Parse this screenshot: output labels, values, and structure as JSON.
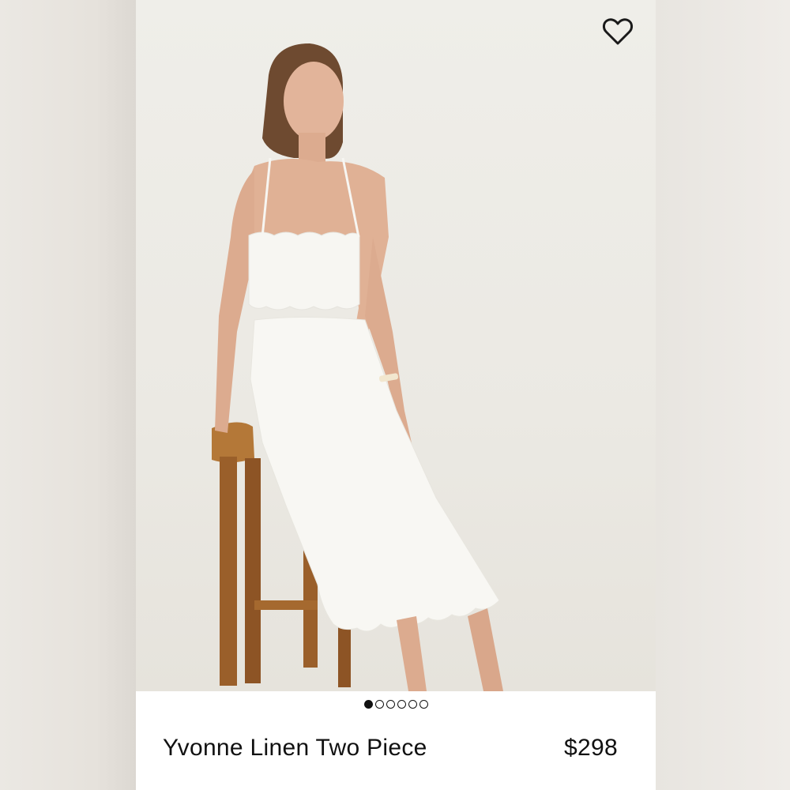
{
  "product": {
    "title": "Yvonne Linen Two Piece",
    "price": "$298"
  },
  "carousel": {
    "image_count": 6,
    "active_index": 0
  },
  "favorite": {
    "icon": "heart-outline-icon",
    "selected": false
  },
  "colors": {
    "text": "#111111",
    "background": "#ffffff"
  }
}
